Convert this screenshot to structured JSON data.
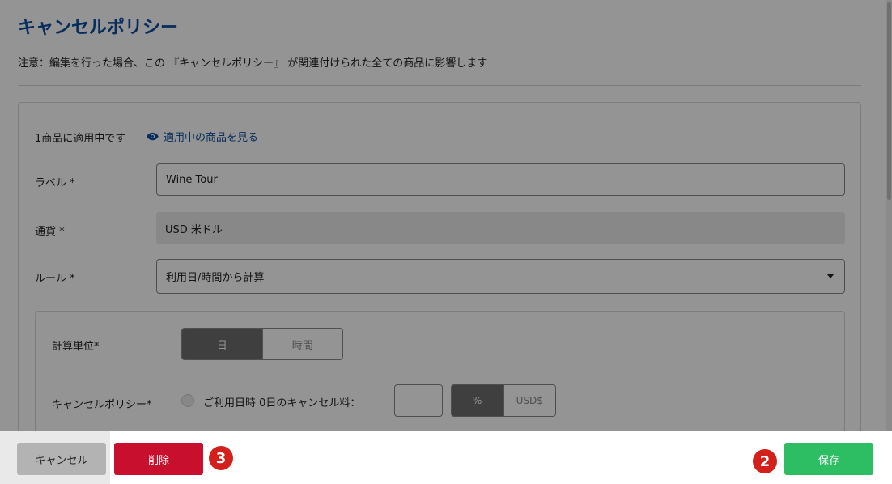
{
  "page": {
    "title": "キャンセルポリシー",
    "notice": "注意：編集を行った場合、この 『キャンセルポリシー』 が関連付けられた全ての商品に影響します"
  },
  "form": {
    "applied_text": "1商品に適用中です",
    "view_link": "適用中の商品を見る",
    "view_icon": "eye-icon",
    "label_field": {
      "label": "ラベル *",
      "value": "Wine Tour"
    },
    "currency_field": {
      "label": "通貨 *",
      "value": "USD 米ドル"
    },
    "rule_field": {
      "label": "ルール *",
      "value": "利用日/時間から計算"
    },
    "unit": {
      "label": "計算単位*",
      "options": [
        "日",
        "時間"
      ],
      "selected": "日"
    },
    "policy": {
      "label": "キャンセルポリシー*",
      "fee_label": "ご利用日時 0日のキャンセル料：",
      "fee_value": "",
      "fee_unit_options": [
        "%",
        "USD$"
      ],
      "fee_unit_selected": "%"
    }
  },
  "footer": {
    "cancel_label": "キャンセル",
    "delete_label": "削除",
    "save_label": "保存",
    "marker_delete": "3",
    "marker_save": "2"
  },
  "colors": {
    "title": "#0b4e9e",
    "delete": "#c8102e",
    "save": "#2dbd62",
    "marker": "#d4201b"
  }
}
